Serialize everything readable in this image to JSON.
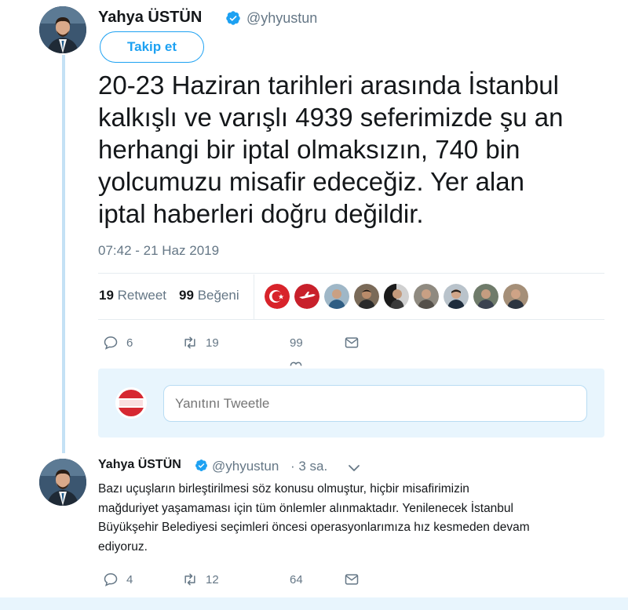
{
  "tweet": {
    "author_name": "Yahya ÜSTÜN",
    "author_handle": "@yhyustun",
    "follow_label": "Takip et",
    "text_lines": [
      "20-23 Haziran tarihleri arasında İstanbul",
      "kalkışlı ve varışlı 4939 seferimizde şu an",
      "herhangi bir iptal olmaksızın, 740 bin",
      "yolcumuzu misafir edeceğiz. Yer alan",
      "iptal haberleri doğru değildir."
    ],
    "timestamp": "07:42 - 21 Haz 2019",
    "retweet_count": "19",
    "retweet_label": "Retweet",
    "like_count": "99",
    "like_label": "Beğeni",
    "actions": {
      "replies": "6",
      "retweets": "19",
      "likes": "99"
    }
  },
  "reply_box": {
    "placeholder": "Yanıtını Tweetle"
  },
  "reply_tweet": {
    "author_name": "Yahya ÜSTÜN",
    "author_handle": "@yhyustun",
    "time_ago": "· 3 sa.",
    "text_lines": [
      "Bazı uçuşların birleştirilmesi söz konusu olmuştur, hiçbir misafirimizin",
      "mağduriyet yaşamaması için tüm önlemler alınmaktadır. Yenilenecek İstanbul",
      "Büyükşehir Belediyesi seçimleri öncesi operasyonlarımıza hız kesmeden devam",
      "ediyoruz."
    ],
    "actions": {
      "replies": "4",
      "retweets": "12",
      "likes": "64"
    }
  },
  "icons": {
    "verified": "verified-badge-icon",
    "reply": "reply-icon",
    "retweet": "retweet-icon",
    "like": "heart-icon",
    "message": "envelope-icon",
    "chevron": "chevron-down-icon"
  },
  "colors": {
    "brand_blue": "#1da1f2",
    "thread_line": "#c4e1f5",
    "muted_text": "#657786",
    "reply_box_bg": "#e8f5fd"
  }
}
